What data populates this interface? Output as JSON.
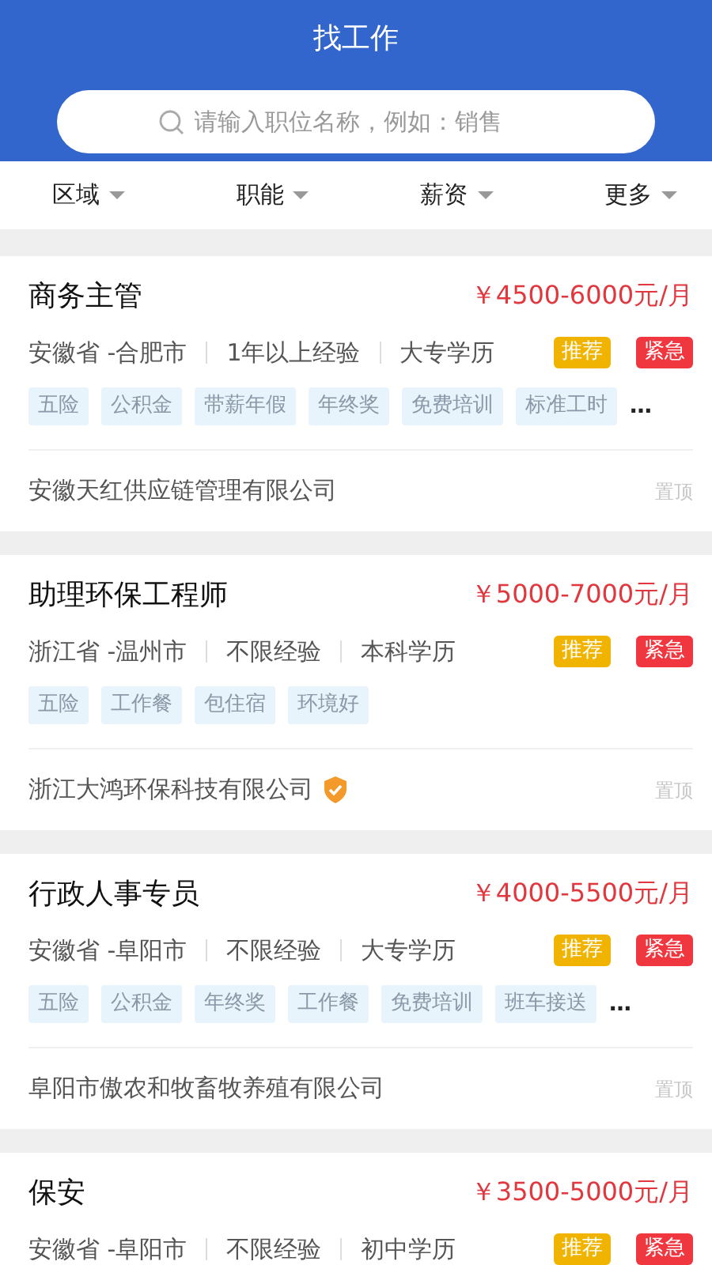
{
  "header": {
    "title": "找工作",
    "search": {
      "placeholder": "请输入职位名称，例如：销售"
    }
  },
  "filters": [
    {
      "label": "区域"
    },
    {
      "label": "职能"
    },
    {
      "label": "薪资"
    },
    {
      "label": "更多"
    }
  ],
  "jobs": [
    {
      "title": "商务主管",
      "salary": "￥4500-6000元/月",
      "location": "安徽省 -合肥市",
      "experience": "1年以上经验",
      "education": "大专学历",
      "badges": [
        {
          "label": "推荐",
          "color": "#f0b400"
        },
        {
          "label": "紧急",
          "color": "#f0363e"
        }
      ],
      "tags": [
        "五险",
        "公积金",
        "带薪年假",
        "年终奖",
        "免费培训",
        "标准工时"
      ],
      "more_mark": "…",
      "company": "安徽天红供应链管理有限公司",
      "verified": false,
      "pin_label": "置顶"
    },
    {
      "title": "助理环保工程师",
      "salary": "￥5000-7000元/月",
      "location": "浙江省 -温州市",
      "experience": "不限经验",
      "education": "本科学历",
      "badges": [
        {
          "label": "推荐",
          "color": "#f0b400"
        },
        {
          "label": "紧急",
          "color": "#f0363e"
        }
      ],
      "tags": [
        "五险",
        "工作餐",
        "包住宿",
        "环境好"
      ],
      "company": "浙江大鸿环保科技有限公司",
      "verified": true,
      "pin_label": "置顶"
    },
    {
      "title": "行政人事专员",
      "salary": "￥4000-5500元/月",
      "location": "安徽省 -阜阳市",
      "experience": "不限经验",
      "education": "大专学历",
      "badges": [
        {
          "label": "推荐",
          "color": "#f0b400"
        },
        {
          "label": "紧急",
          "color": "#f0363e"
        }
      ],
      "tags": [
        "五险",
        "公积金",
        "年终奖",
        "工作餐",
        "免费培训",
        "班车接送"
      ],
      "more_mark": "…",
      "company": "阜阳市傲农和牧畜牧养殖有限公司",
      "verified": false,
      "pin_label": "置顶"
    },
    {
      "title": "保安",
      "salary": "￥3500-5000元/月",
      "location": "安徽省 -阜阳市",
      "experience": "不限经验",
      "education": "初中学历",
      "badges": [
        {
          "label": "推荐",
          "color": "#f0b400"
        },
        {
          "label": "紧急",
          "color": "#f0363e"
        }
      ],
      "verified": false
    }
  ]
}
